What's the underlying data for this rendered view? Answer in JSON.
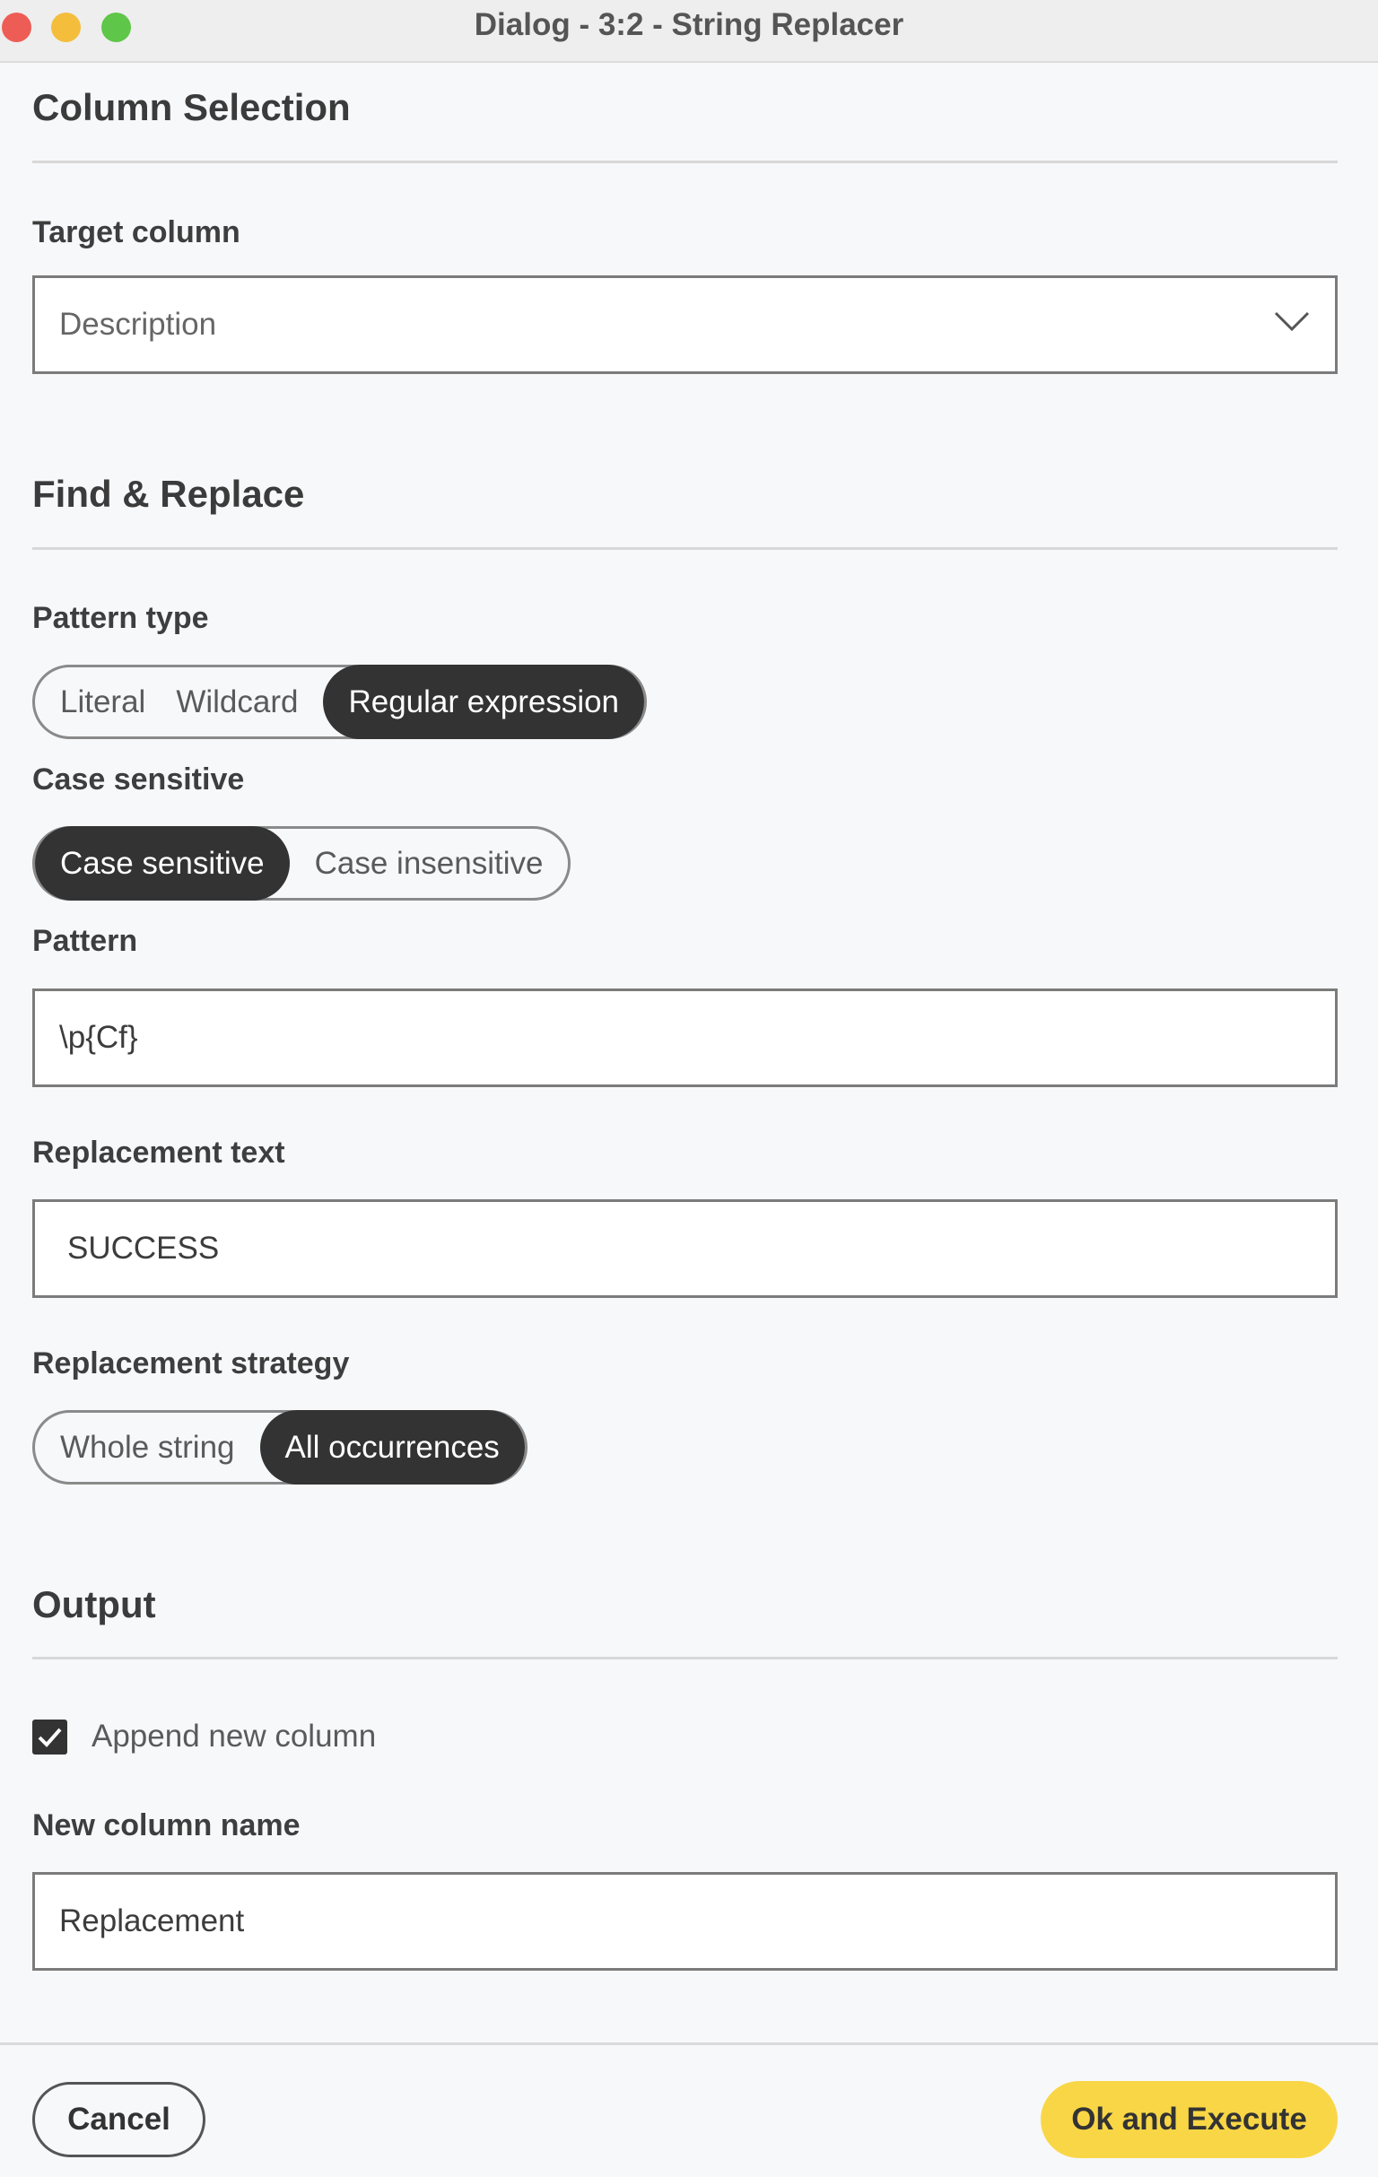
{
  "window": {
    "title": "Dialog - 3:2 - String Replacer"
  },
  "column_selection": {
    "heading": "Column Selection",
    "target_column_label": "Target column",
    "target_column_value": "Description"
  },
  "find_replace": {
    "heading": "Find & Replace",
    "pattern_type_label": "Pattern type",
    "pattern_type_options": [
      "Literal",
      "Wildcard",
      "Regular expression"
    ],
    "pattern_type_selected": "Regular expression",
    "case_label": "Case sensitive",
    "case_options": [
      "Case sensitive",
      "Case insensitive"
    ],
    "case_selected": "Case sensitive",
    "pattern_label": "Pattern",
    "pattern_value": "\\p{Cf}",
    "replacement_label": "Replacement text",
    "replacement_value": "SUCCESS",
    "strategy_label": "Replacement strategy",
    "strategy_options": [
      "Whole string",
      "All occurrences"
    ],
    "strategy_selected": "All occurrences"
  },
  "output": {
    "heading": "Output",
    "append_checked": true,
    "append_label": "Append new column",
    "new_column_label": "New column name",
    "new_column_value": "Replacement"
  },
  "footer": {
    "cancel_label": "Cancel",
    "ok_label": "Ok and Execute"
  },
  "colors": {
    "active_toggle": "#333333",
    "primary_button": "#f9d645",
    "traffic_red": "#ee5d55",
    "traffic_yellow": "#f4bd3c",
    "traffic_green": "#5ec648"
  }
}
